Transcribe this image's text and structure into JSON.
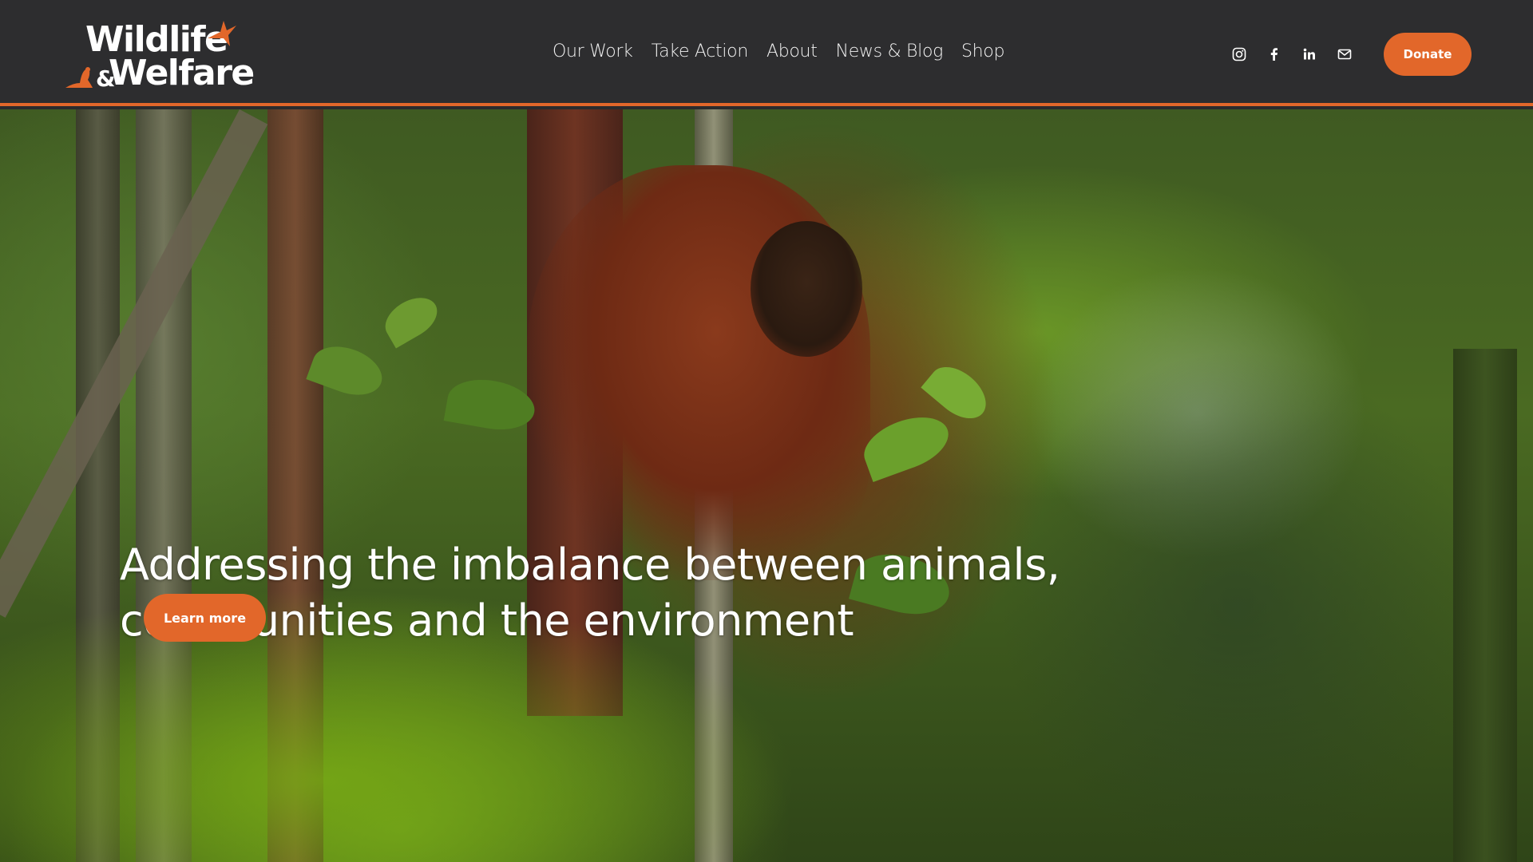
{
  "header": {
    "logo": {
      "line1": "Wildlife",
      "amp": "&",
      "line2": "Welfare"
    },
    "nav": [
      {
        "label": "Our Work"
      },
      {
        "label": "Take Action"
      },
      {
        "label": "About"
      },
      {
        "label": "News & Blog"
      },
      {
        "label": "Shop"
      }
    ],
    "social_icons": [
      "instagram-icon",
      "facebook-icon",
      "linkedin-icon",
      "email-icon"
    ],
    "donate_label": "Donate"
  },
  "hero": {
    "title": "Addressing the imbalance between animals, communities and the environment",
    "cta_label": "Learn more"
  },
  "colors": {
    "accent": "#e2672a",
    "header_bg": "#2d2d2f",
    "text": "#ffffff"
  }
}
